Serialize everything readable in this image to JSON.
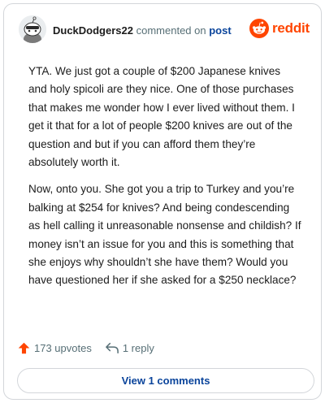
{
  "header": {
    "username": "DuckDodgers22",
    "commented_text": "commented on",
    "post_link": "post",
    "logo_text": "reddit"
  },
  "comment": {
    "paragraphs": [
      "YTA. We just got a couple of $200 Japanese knives and holy spicoli are they nice. One of those purchases that makes me wonder how I ever lived without them. I get it that for a lot of people $200 knives are out of the question and but if you can afford them they’re absolutely worth it.",
      "Now, onto you. She got you a trip to Turkey and you’re balking at $254 for knives? And being condescending as hell calling it unreasonable nonsense and childish? If money isn’t an issue for you and this is something that she enjoys why shouldn’t she have them? Would you have questioned her if she asked for a $250 necklace?"
    ]
  },
  "actions": {
    "upvotes": "173 upvotes",
    "replies": "1 reply",
    "view_button": "View 1 comments"
  },
  "colors": {
    "accent": "#ff4500",
    "link": "#0a449b",
    "muted": "#576f76",
    "border": "#d3d6da"
  },
  "icons": [
    "snoo-avatar",
    "reddit-logo-icon",
    "upvote-arrow-icon",
    "reply-icon"
  ]
}
